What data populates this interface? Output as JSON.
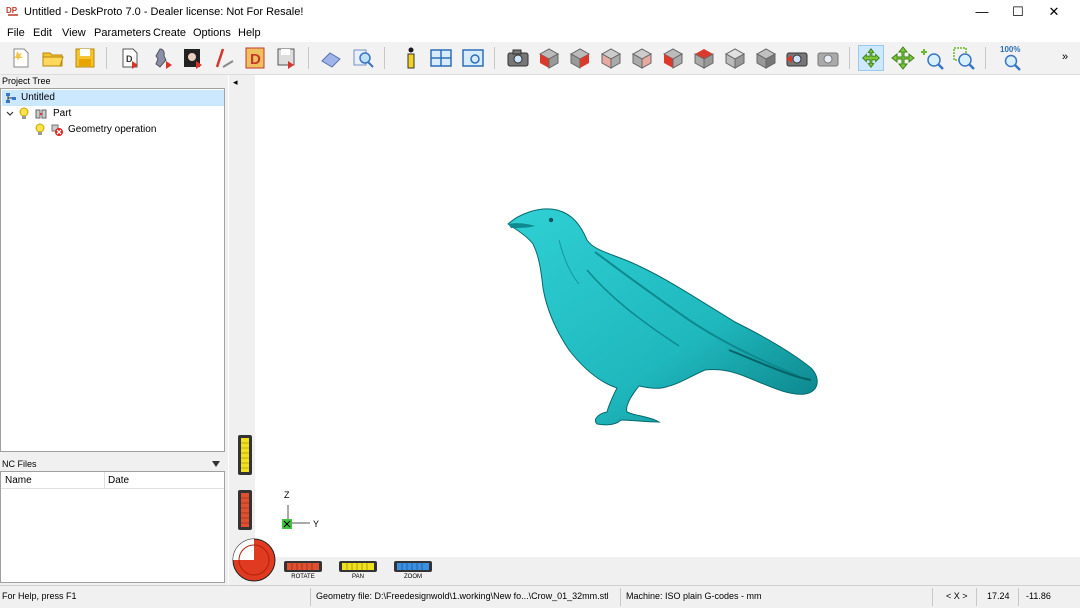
{
  "window": {
    "title": "Untitled - DeskProto 7.0 - Dealer license: Not For Resale!",
    "minimize": "—",
    "maximize": "☐",
    "close": "✕"
  },
  "menu": [
    "File",
    "Edit",
    "View",
    "Parameters",
    "Create",
    "Options",
    "Help"
  ],
  "toolbar": {
    "zoom_percent": "100%",
    "overflow": "»"
  },
  "project_tree": {
    "header": "Project Tree",
    "root": "Untitled",
    "part": "Part",
    "operation": "Geometry operation"
  },
  "nc_files": {
    "header": "NC Files",
    "columns": [
      "Name",
      "Date"
    ]
  },
  "viewport": {
    "axis_z": "Z",
    "axis_y": "Y",
    "rotate_label": "ROTATE",
    "pan_label": "PAN",
    "zoom_label": "ZOOM",
    "collapse_arrow": "◂",
    "model_color": "#1fb8bd"
  },
  "status": {
    "help": "For Help, press F1",
    "geometry": "Geometry file: D:\\Freedesignwold\\1.working\\New fo...\\Crow_01_32mm.stl",
    "machine": "Machine: ISO plain G-codes - mm",
    "nav": "< X >",
    "x_val": "17.24",
    "y_val": "-11.86"
  }
}
